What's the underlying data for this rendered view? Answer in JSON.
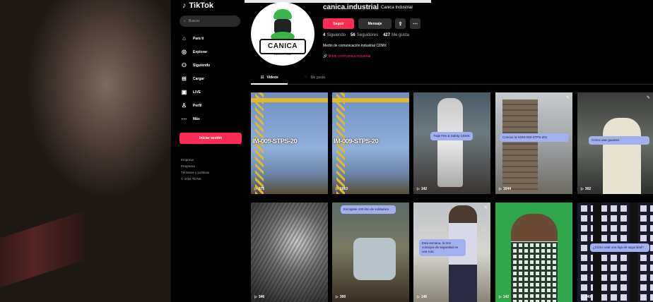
{
  "app": {
    "name": "TikTok"
  },
  "sidebar": {
    "search_placeholder": "Buscar",
    "items": [
      {
        "label": "Para ti",
        "icon": "home-icon"
      },
      {
        "label": "Explorar",
        "icon": "compass-icon"
      },
      {
        "label": "Siguiendo",
        "icon": "following-icon"
      },
      {
        "label": "Cargar",
        "icon": "upload-icon"
      },
      {
        "label": "LIVE",
        "icon": "live-icon"
      },
      {
        "label": "Perfil",
        "icon": "profile-icon"
      },
      {
        "label": "Más",
        "icon": "more-icon"
      }
    ],
    "login_label": "Iniciar sesión",
    "footer": [
      "Empresa",
      "Programa",
      "Términos y políticas",
      "© 2024 TikTok"
    ]
  },
  "profile": {
    "username": "canica.industrial",
    "nickname": "Canica Industrial",
    "avatar_brand": "CANICA",
    "avatar_sub": "INDUSTRIAL",
    "follow_label": "Seguir",
    "message_label": "Mensaje",
    "stats": {
      "following": {
        "value": "4",
        "label": "Siguiendo"
      },
      "followers": {
        "value": "56",
        "label": "Seguidores"
      },
      "likes": {
        "value": "427",
        "label": "Me gusta"
      }
    },
    "bio": "Medio de comunicación industrial CDMX",
    "link": "🔗 tiktok.com/canica.industrial"
  },
  "tabs": [
    {
      "label": "Videos",
      "icon": "grid-icon"
    },
    {
      "label": "Me gusta",
      "icon": "heart-icon"
    }
  ],
  "videos": [
    {
      "views": "375",
      "overlay": "IM-009-STPS-20",
      "caption": ""
    },
    {
      "views": "1663",
      "overlay": "IM-009-STPS-20",
      "caption": ""
    },
    {
      "views": "142",
      "overlay": "",
      "caption": "Traje Fire & Safety CDMX"
    },
    {
      "views": "1644",
      "overlay": "",
      "caption": "Conoce la NOM-009-STPS-201"
    },
    {
      "views": "302",
      "overlay": "",
      "caption": "Cómo usar guantes"
    },
    {
      "views": "346",
      "overlay": "",
      "caption": ""
    },
    {
      "views": "300",
      "overlay": "",
      "caption": "Escogiste 100 litro de soldadura"
    },
    {
      "views": "146",
      "overlay": "",
      "caption": "Esta semana, la tres consejos de seguridad en una ruta"
    },
    {
      "views": "142",
      "overlay": "",
      "caption": ""
    },
    {
      "views": "240",
      "overlay": "",
      "caption": "¿Cómo usar una faja de seguridad?"
    }
  ]
}
